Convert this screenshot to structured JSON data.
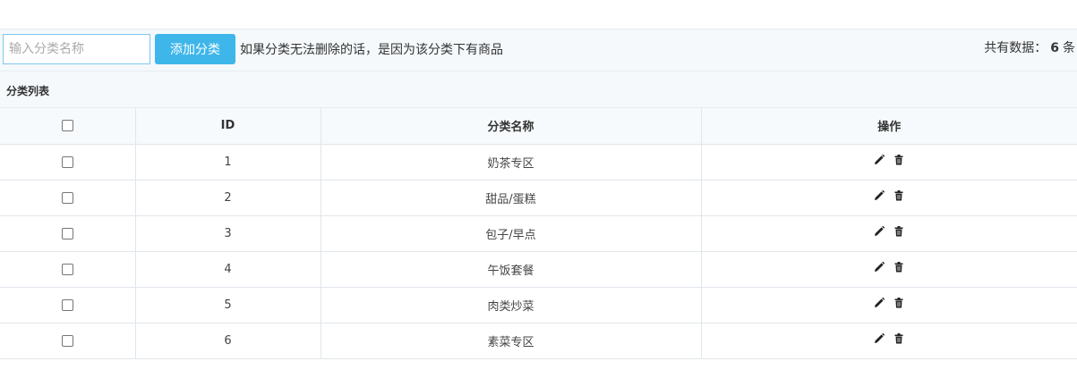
{
  "toolbar": {
    "search_placeholder": "输入分类名称",
    "add_button": "添加分类",
    "hint": "如果分类无法删除的话，是因为该分类下有商品",
    "count_prefix": "共有数据：",
    "count_value": "6",
    "count_suffix": "条"
  },
  "list": {
    "title": "分类列表",
    "columns": {
      "id": "ID",
      "name": "分类名称",
      "actions": "操作"
    },
    "rows": [
      {
        "id": "1",
        "name": "奶茶专区"
      },
      {
        "id": "2",
        "name": "甜品/蛋糕"
      },
      {
        "id": "3",
        "name": "包子/早点"
      },
      {
        "id": "4",
        "name": "午饭套餐"
      },
      {
        "id": "5",
        "name": "肉类炒菜"
      },
      {
        "id": "6",
        "name": "素菜专区"
      }
    ],
    "row_icons": [
      "edit-icon",
      "delete-icon"
    ]
  },
  "colors": {
    "accent": "#3fb6ea",
    "header_bg": "#f5f9fc",
    "border": "#e1e6eb"
  }
}
